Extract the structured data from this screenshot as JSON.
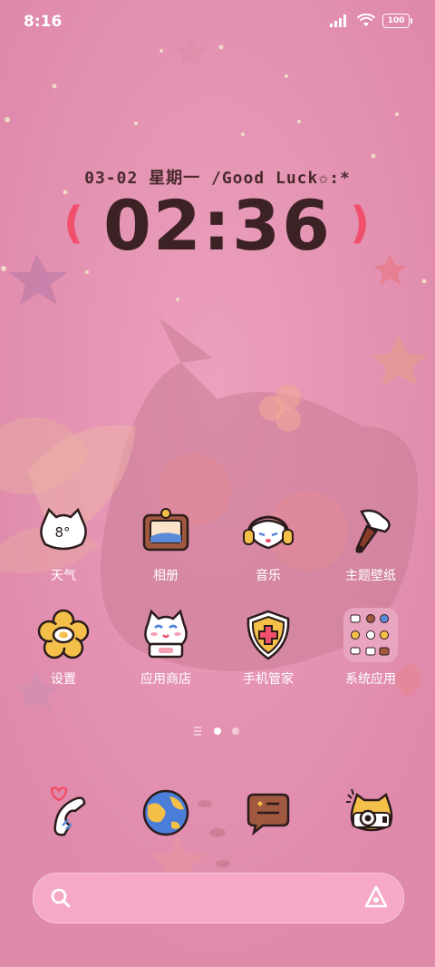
{
  "status_bar": {
    "time": "8:16",
    "battery": "100"
  },
  "clock_widget": {
    "date_line": "03-02 星期一 /Good Luck✩:*",
    "time": "02:36",
    "paren_left": "(",
    "paren_right": ")"
  },
  "apps": [
    {
      "label": "天气",
      "icon": "weather-cat-icon",
      "temp": "8°"
    },
    {
      "label": "相册",
      "icon": "gallery-frame-icon"
    },
    {
      "label": "音乐",
      "icon": "music-cat-headphones-icon"
    },
    {
      "label": "主题壁纸",
      "icon": "theme-paintbrush-icon"
    },
    {
      "label": "设置",
      "icon": "settings-flower-icon"
    },
    {
      "label": "应用商店",
      "icon": "app-store-cat-icon"
    },
    {
      "label": "手机管家",
      "icon": "security-shield-icon"
    },
    {
      "label": "系统应用",
      "icon": "system-apps-folder-icon"
    }
  ],
  "dock": [
    {
      "name": "phone",
      "icon": "phone-handset-icon"
    },
    {
      "name": "browser",
      "icon": "browser-planet-icon"
    },
    {
      "name": "messages",
      "icon": "message-bubble-icon"
    },
    {
      "name": "camera",
      "icon": "camera-cat-icon"
    }
  ],
  "page_indicator": {
    "pages": 2,
    "current": 1
  },
  "colors": {
    "background": "#e592b2",
    "accent": "#f0506b",
    "clock_text": "#3c2224"
  }
}
